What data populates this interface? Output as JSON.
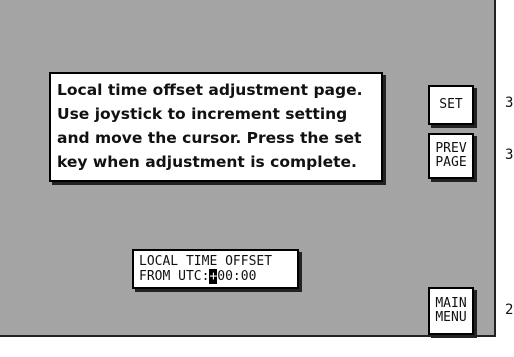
{
  "info_message": {
    "lines": [
      "Local time offset adjustment page.",
      "Use joystick to increment setting",
      "and move the cursor. Press the set",
      "key when adjustment is complete."
    ]
  },
  "offset_display": {
    "label": "LOCAL TIME OFFSET",
    "prefix": "FROM UTC:",
    "cursor_char": "+",
    "value": "00:00"
  },
  "softkeys": {
    "set": {
      "label": "SET"
    },
    "prev_page": {
      "line1": "PREV",
      "line2": "PAGE"
    },
    "main_menu": {
      "line1": "MAIN",
      "line2": "MENU"
    }
  },
  "side_numbers": {
    "set": "3",
    "prev_page": "3",
    "main_menu": "2"
  },
  "colors": {
    "screen_background": "#a4a4a4",
    "panel_background": "#ffffff",
    "border": "#000000"
  }
}
